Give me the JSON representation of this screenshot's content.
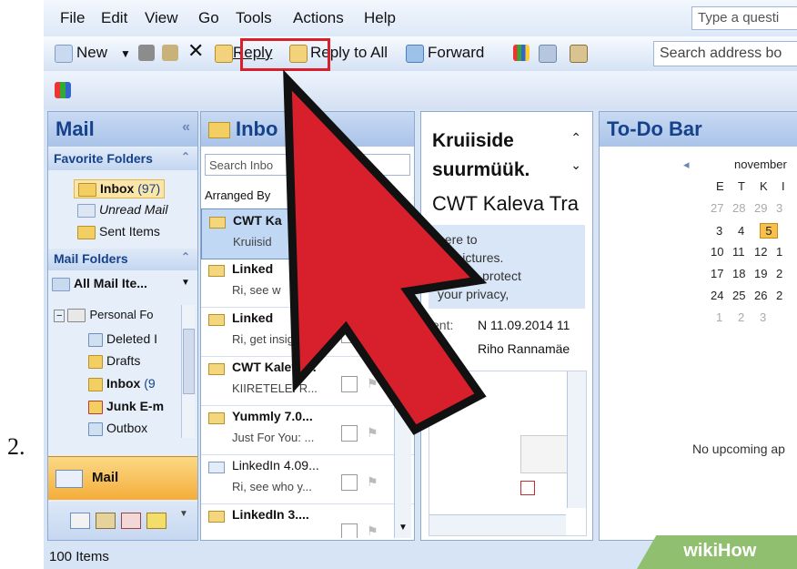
{
  "step_number": "2.",
  "menu": [
    "File",
    "Edit",
    "View",
    "Go",
    "Tools",
    "Actions",
    "Help"
  ],
  "help_search_placeholder": "Type a questi",
  "toolbar": {
    "new_label": "New",
    "reply_label": "Reply",
    "reply_all_label": "Reply to All",
    "forward_label": "Forward",
    "address_book_placeholder": "Search address bo"
  },
  "nav": {
    "title": "Mail",
    "favorite_header": "Favorite Folders",
    "favorites": [
      {
        "label": "Inbox",
        "count": "(97)"
      },
      {
        "label": "Unread Mail"
      },
      {
        "label": "Sent Items"
      }
    ],
    "mail_folders_header": "Mail Folders",
    "all_mail_items": "All Mail Ite...",
    "tree": [
      {
        "label": "Personal Fo"
      },
      {
        "label": "Deleted I"
      },
      {
        "label": "Drafts"
      },
      {
        "label": "Inbox",
        "count": "(9"
      },
      {
        "label": "Junk E-m"
      },
      {
        "label": "Outbox"
      }
    ],
    "mail_button": "Mail"
  },
  "inbox": {
    "title": "Inbo",
    "search_placeholder": "Search Inbo",
    "arranged_by": "Arranged By",
    "messages": [
      {
        "from": "CWT Ka",
        "preview": "Kruiisid"
      },
      {
        "from": "Linked",
        "preview": "Ri, see w"
      },
      {
        "from": "Linked",
        "preview": "Ri, get insigh..."
      },
      {
        "from": "CWT Kaleva...",
        "preview": "KIIRETELE! R..."
      },
      {
        "from": "Yummly 7.0...",
        "preview": "Just For You: ..."
      },
      {
        "from": "LinkedIn 4.09...",
        "preview": "Ri, see who y..."
      },
      {
        "from": "LinkedIn  3....",
        "preview": ""
      }
    ]
  },
  "reading": {
    "subject_line1": "Kruiiside",
    "subject_line2": "suurmüük.",
    "sender": "CWT Kaleva Tra",
    "info_line1": "here to",
    "info_line2": "ad pictures.",
    "info_line3": "To help protect",
    "info_line4": "your privacy,",
    "sent_label": "ent:",
    "sent_value": "N 11.09.2014 11",
    "to_value": "Riho Rannamäe"
  },
  "todo": {
    "title": "To-Do Bar",
    "month": "november",
    "weekdays": [
      "E",
      "T",
      "K",
      "I"
    ],
    "weeks": [
      [
        "27",
        "28",
        "29",
        "3"
      ],
      [
        "3",
        "4",
        "5",
        ""
      ],
      [
        "10",
        "11",
        "12",
        "1"
      ],
      [
        "17",
        "18",
        "19",
        "2"
      ],
      [
        "24",
        "25",
        "26",
        "2"
      ],
      [
        "1",
        "2",
        "3",
        ""
      ]
    ],
    "today": "5",
    "no_appointments": "No upcoming ap"
  },
  "status": "100 Items",
  "watermark": "wikiHow",
  "colors": {
    "highlight_red": "#d8202c",
    "arrow_red": "#d8202c",
    "header_blue": "#15428b",
    "today_orange": "#f6c04e"
  }
}
